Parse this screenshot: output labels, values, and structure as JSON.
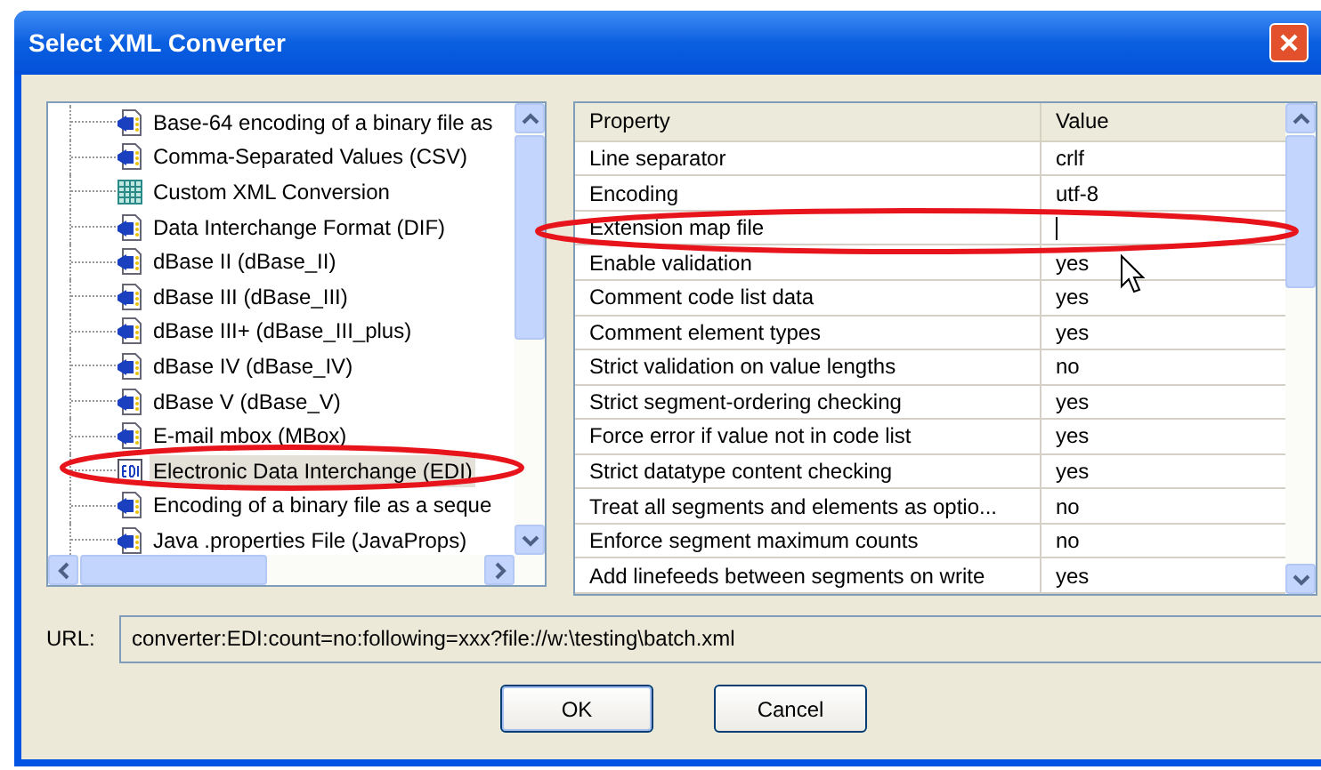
{
  "window": {
    "title": "Select XML Converter"
  },
  "converters": [
    {
      "label": "Base-64 encoding of a binary file as",
      "kind": "plugin",
      "selected": false
    },
    {
      "label": "Comma-Separated Values (CSV)",
      "kind": "plugin",
      "selected": false
    },
    {
      "label": "Custom XML Conversion",
      "kind": "table",
      "selected": false
    },
    {
      "label": "Data Interchange Format (DIF)",
      "kind": "plugin",
      "selected": false
    },
    {
      "label": "dBase II (dBase_II)",
      "kind": "plugin",
      "selected": false
    },
    {
      "label": "dBase III (dBase_III)",
      "kind": "plugin",
      "selected": false
    },
    {
      "label": "dBase III+ (dBase_III_plus)",
      "kind": "plugin",
      "selected": false
    },
    {
      "label": "dBase IV (dBase_IV)",
      "kind": "plugin",
      "selected": false
    },
    {
      "label": "dBase V (dBase_V)",
      "kind": "plugin",
      "selected": false
    },
    {
      "label": "E-mail mbox (MBox)",
      "kind": "plugin",
      "selected": false
    },
    {
      "label": "Electronic Data Interchange (EDI)",
      "kind": "edi",
      "selected": true
    },
    {
      "label": "Encoding of a binary file as a seque",
      "kind": "plugin",
      "selected": false
    },
    {
      "label": "Java .properties File (JavaProps)",
      "kind": "plugin",
      "selected": false
    }
  ],
  "properties": {
    "columns": [
      "Property",
      "Value"
    ],
    "rows": [
      {
        "property": "Line separator",
        "value": "crlf",
        "editing": false
      },
      {
        "property": "Encoding",
        "value": "utf-8",
        "editing": false
      },
      {
        "property": "Extension map file",
        "value": "",
        "editing": true
      },
      {
        "property": "Enable validation",
        "value": "yes",
        "editing": false
      },
      {
        "property": "Comment code list data",
        "value": "yes",
        "editing": false
      },
      {
        "property": "Comment element types",
        "value": "yes",
        "editing": false
      },
      {
        "property": "Strict validation on value lengths",
        "value": "no",
        "editing": false
      },
      {
        "property": "Strict segment-ordering checking",
        "value": "yes",
        "editing": false
      },
      {
        "property": "Force error if value not in code list",
        "value": "yes",
        "editing": false
      },
      {
        "property": "Strict datatype content checking",
        "value": "yes",
        "editing": false
      },
      {
        "property": "Treat all segments and elements as optio...",
        "value": "no",
        "editing": false
      },
      {
        "property": "Enforce segment maximum counts",
        "value": "no",
        "editing": false
      },
      {
        "property": "Add linefeeds between segments on write",
        "value": "yes",
        "editing": false
      }
    ]
  },
  "url": {
    "label": "URL:",
    "value": "converter:EDI:count=no:following=xxx?file://w:\\testing\\batch.xml"
  },
  "buttons": [
    "OK",
    "Cancel"
  ]
}
